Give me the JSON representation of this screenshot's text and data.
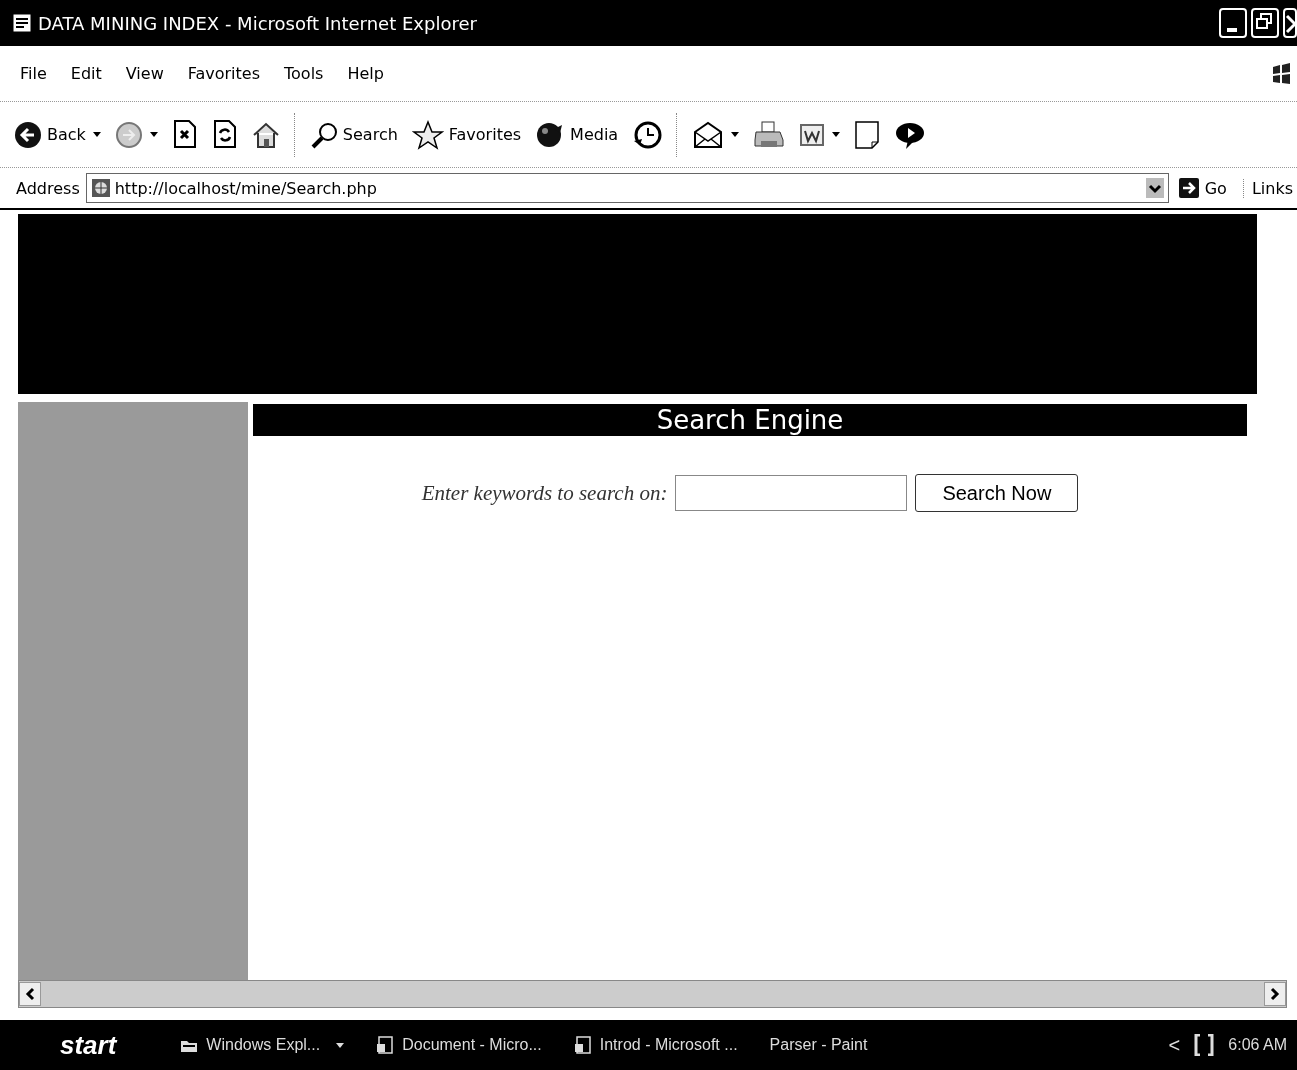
{
  "window": {
    "title": "DATA MINING INDEX - Microsoft Internet Explorer"
  },
  "menu": [
    "File",
    "Edit",
    "View",
    "Favorites",
    "Tools",
    "Help"
  ],
  "toolbar": [
    {
      "kind": "back",
      "label": "Back",
      "dropdown": true
    },
    {
      "kind": "forward",
      "dropdown": true
    },
    {
      "kind": "stop",
      "dropdown": false
    },
    {
      "kind": "refresh",
      "dropdown": false
    },
    {
      "kind": "home",
      "dropdown": false
    },
    {
      "kind": "search",
      "label": "Search",
      "dropdown": false
    },
    {
      "kind": "favorites",
      "label": "Favorites",
      "dropdown": false
    },
    {
      "kind": "media",
      "label": "Media",
      "dropdown": false
    },
    {
      "kind": "history",
      "dropdown": false
    },
    {
      "kind": "mail",
      "dropdown": true
    },
    {
      "kind": "print",
      "dropdown": false
    },
    {
      "kind": "edit",
      "dropdown": true
    },
    {
      "kind": "note",
      "dropdown": false
    },
    {
      "kind": "messenger",
      "dropdown": false
    }
  ],
  "address": {
    "label": "Address",
    "value": "http://localhost/mine/Search.php",
    "go": "Go",
    "links": "Links"
  },
  "page": {
    "heading": "Search Engine",
    "prompt": "Enter keywords to search on:",
    "button": "Search Now"
  },
  "taskbar": {
    "start": "start",
    "items": [
      {
        "kind": "folder",
        "label": "Windows Expl...",
        "dropdown": true
      },
      {
        "kind": "document",
        "label": "Document - Micro...",
        "dropdown": false
      },
      {
        "kind": "document",
        "label": "Introd - Microsoft ...",
        "dropdown": false
      },
      {
        "kind": "plain",
        "label": "Parser - Paint",
        "dropdown": false
      }
    ],
    "tray_toggle": "<",
    "clock": "6:06 AM"
  }
}
